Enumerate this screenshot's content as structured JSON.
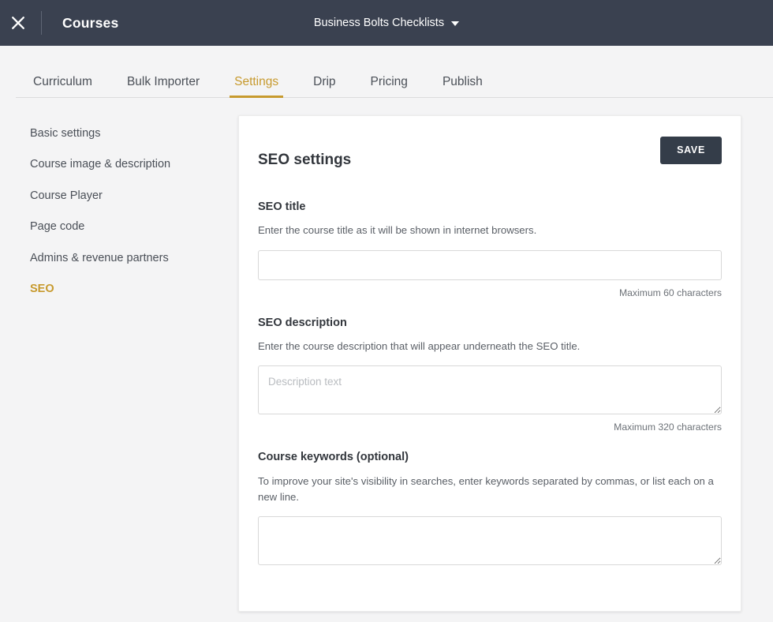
{
  "topbar": {
    "close_icon": "close-x-icon",
    "app_title": "Courses",
    "course_name": "Business Bolts Checklists",
    "caret_icon": "chevron-down-icon",
    "background": "#3a4150"
  },
  "tabs": {
    "accent": "#c79a2e",
    "items": [
      {
        "label": "Curriculum",
        "active": false
      },
      {
        "label": "Bulk Importer",
        "active": false
      },
      {
        "label": "Settings",
        "active": true
      },
      {
        "label": "Drip",
        "active": false
      },
      {
        "label": "Pricing",
        "active": false
      },
      {
        "label": "Publish",
        "active": false
      }
    ]
  },
  "sidenav": {
    "items": [
      {
        "label": "Basic settings",
        "active": false
      },
      {
        "label": "Course image & description",
        "active": false
      },
      {
        "label": "Course Player",
        "active": false
      },
      {
        "label": "Page code",
        "active": false
      },
      {
        "label": "Admins & revenue partners",
        "active": false
      },
      {
        "label": "SEO",
        "active": true
      }
    ]
  },
  "card": {
    "title": "SEO settings",
    "save_label": "SAVE",
    "save_color": "#343d49",
    "fields": {
      "seo_title": {
        "label": "SEO title",
        "help": "Enter the course title as it will be shown in internet browsers.",
        "value": "",
        "placeholder": "",
        "counter": "Maximum 60 characters"
      },
      "seo_description": {
        "label": "SEO description",
        "help": "Enter the course description that will appear underneath the SEO title.",
        "value": "",
        "placeholder": "Description text",
        "counter": "Maximum 320 characters"
      },
      "course_keywords": {
        "label": "Course keywords (optional)",
        "help": "To improve your site's visibility in searches, enter keywords separated by commas, or list each on a new line.",
        "value": "",
        "placeholder": ""
      }
    }
  }
}
